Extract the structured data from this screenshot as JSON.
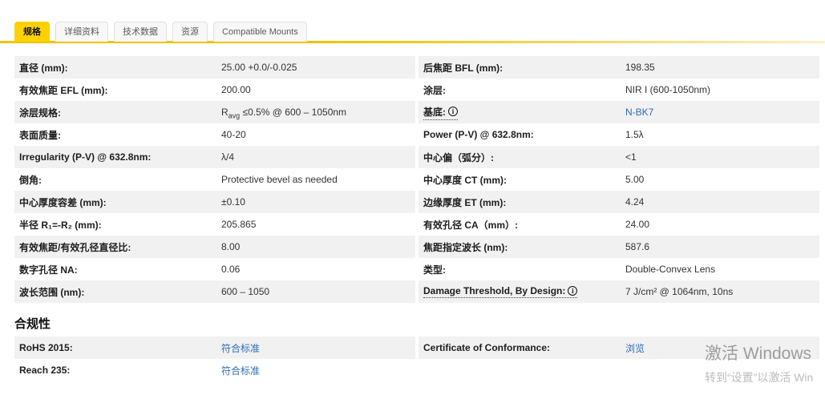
{
  "tabs": [
    {
      "label": "规格",
      "active": true
    },
    {
      "label": "详细资料",
      "active": false
    },
    {
      "label": "技术数据",
      "active": false
    },
    {
      "label": "资源",
      "active": false
    },
    {
      "label": "Compatible Mounts",
      "active": false
    }
  ],
  "colors": {
    "accent_yellow": "#ffd100",
    "row_stripe_gray": "#f1f1f2",
    "link_blue": "#2f6cb5"
  },
  "specs": {
    "left": [
      {
        "label": "直径 (mm):",
        "value": "25.00 +0.0/-0.025"
      },
      {
        "label": "有效焦距 EFL (mm):",
        "value": "200.00"
      },
      {
        "label": "涂层规格:",
        "value_parts": [
          {
            "t": "R"
          },
          {
            "t": "avg",
            "sub": true
          },
          {
            "t": " ≤0.5% @ 600 – 1050nm"
          }
        ]
      },
      {
        "label": "表面质量:",
        "value": "40-20"
      },
      {
        "label": "Irregularity (P-V) @ 632.8nm:",
        "value": "λ/4"
      },
      {
        "label": "倒角:",
        "value": "Protective bevel as needed"
      },
      {
        "label": "中心厚度容差 (mm):",
        "value": "±0.10"
      },
      {
        "label": "半径 R₁=-R₂ (mm):",
        "value": "205.865"
      },
      {
        "label": "有效焦距/有效孔径直径比:",
        "value": "8.00"
      },
      {
        "label": "数字孔径 NA:",
        "value": "0.06"
      },
      {
        "label": "波长范围 (nm):",
        "value": "600 – 1050"
      }
    ],
    "right": [
      {
        "label": "后焦距 BFL (mm):",
        "value": "198.35"
      },
      {
        "label": "涂层:",
        "value": "NIR I (600-1050nm)"
      },
      {
        "label": "基底:",
        "value": "N-BK7",
        "link": true,
        "info": true
      },
      {
        "label": "Power (P-V) @ 632.8nm:",
        "value": "1.5λ"
      },
      {
        "label": "中心偏（弧分）:",
        "value": "<1"
      },
      {
        "label": "中心厚度 CT (mm):",
        "value": "5.00"
      },
      {
        "label": "边缘厚度 ET (mm):",
        "value": "4.24"
      },
      {
        "label": "有效孔径 CA（mm）:",
        "value": "24.00"
      },
      {
        "label": "焦距指定波长 (nm):",
        "value": "587.6"
      },
      {
        "label": "类型:",
        "value": "Double-Convex Lens"
      },
      {
        "label": "Damage Threshold, By Design:",
        "value": "7 J/cm² @ 1064nm, 10ns",
        "info": true
      }
    ]
  },
  "compliance": {
    "title": "合规性",
    "left": [
      {
        "label": "RoHS 2015:",
        "value": "符合标准",
        "link": true
      },
      {
        "label": "Reach 235:",
        "value": "符合标准",
        "link": true
      }
    ],
    "right": [
      {
        "label": "Certificate of Conformance:",
        "value": "浏览",
        "link": true
      }
    ]
  },
  "watermark": {
    "line1": "激活 Windows",
    "line2": "转到“设置”以激活 Win"
  }
}
